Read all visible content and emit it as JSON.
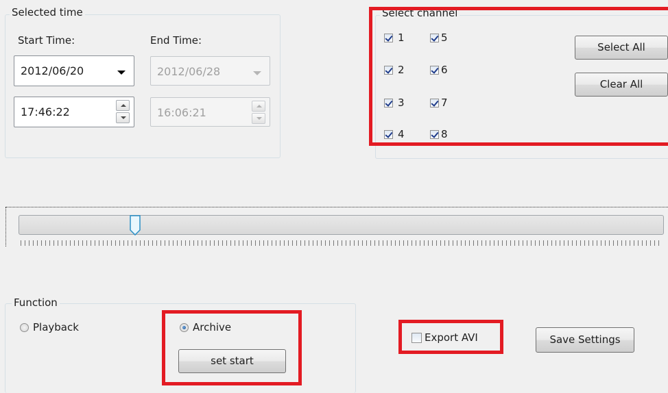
{
  "selected_time": {
    "legend": "Selected time",
    "start_label": "Start Time:",
    "end_label": "End Time:",
    "start_date": "2012/06/20",
    "end_date": "2012/06/28",
    "start_time": "17:46:22",
    "end_time": "16:06:21"
  },
  "channels": {
    "legend": "Select channel",
    "items": [
      {
        "label": "1",
        "checked": true
      },
      {
        "label": "2",
        "checked": true
      },
      {
        "label": "3",
        "checked": true
      },
      {
        "label": "4",
        "checked": true
      },
      {
        "label": "5",
        "checked": true
      },
      {
        "label": "6",
        "checked": true
      },
      {
        "label": "7",
        "checked": true
      },
      {
        "label": "8",
        "checked": true
      }
    ],
    "select_all_label": "Select All",
    "clear_all_label": "Clear All"
  },
  "timeline": {
    "position_fraction": 0.18
  },
  "function": {
    "legend": "Function",
    "playback_label": "Playback",
    "playback_selected": false,
    "archive_label": "Archive",
    "archive_selected": true,
    "set_start_label": "set start"
  },
  "export_avi": {
    "label": "Export AVI",
    "checked": false
  },
  "save_settings_label": "Save Settings",
  "colors": {
    "highlight": "#e31b23",
    "background": "#f0f0f0"
  }
}
